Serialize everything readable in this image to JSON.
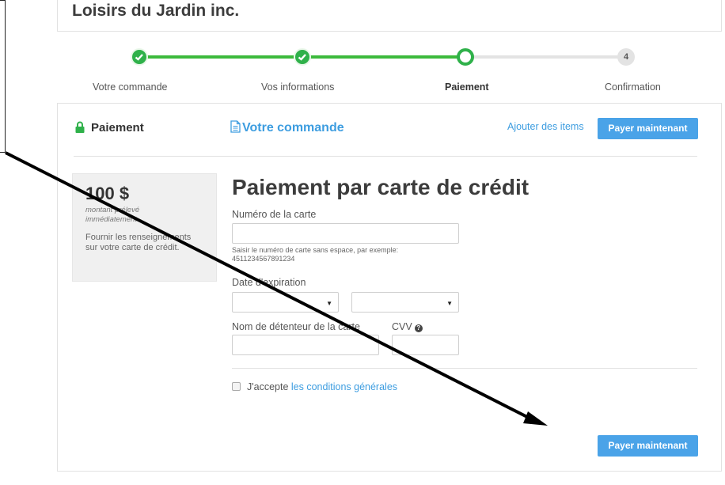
{
  "header": {
    "store_name": "Loisirs du Jardin inc."
  },
  "steps": [
    {
      "label": "Votre commande",
      "state": "done"
    },
    {
      "label": "Vos informations",
      "state": "done"
    },
    {
      "label": "Paiement",
      "state": "current"
    },
    {
      "label": "Confirmation",
      "state": "future",
      "number": "4"
    }
  ],
  "tabs": {
    "payment": "Paiement",
    "order": "Votre commande"
  },
  "actions": {
    "add_items": "Ajouter des items",
    "pay_now": "Payer maintenant"
  },
  "summary": {
    "amount": "100 $",
    "amount_note": "montant prélevé immédiatement",
    "description": "Fournir les renseignements sur votre carte de crédit."
  },
  "form": {
    "title": "Paiement par carte de crédit",
    "card_number_label": "Numéro de la carte",
    "card_number_value": "",
    "card_number_hint": "Saisir le numéro de carte sans espace, par exemple: 4511234567891234",
    "expiry_label": "Date d'expiration",
    "expiry_month_value": "",
    "expiry_year_value": "",
    "holder_label": "Nom de détenteur de la carte",
    "holder_value": "",
    "cvv_label": "CVV",
    "cvv_value": "",
    "terms_prefix": "J'accepte",
    "terms_link": "les conditions générales"
  },
  "colors": {
    "accent": "#4aa3e8",
    "link": "#3d9de0",
    "progress_done": "#2fb14a",
    "progress_pending": "#e3e3e3"
  },
  "icons": {
    "lock": "lock-icon",
    "document": "document-icon",
    "check": "check-icon",
    "help": "help-circle-icon",
    "dropdown": "chevron-down-icon"
  }
}
